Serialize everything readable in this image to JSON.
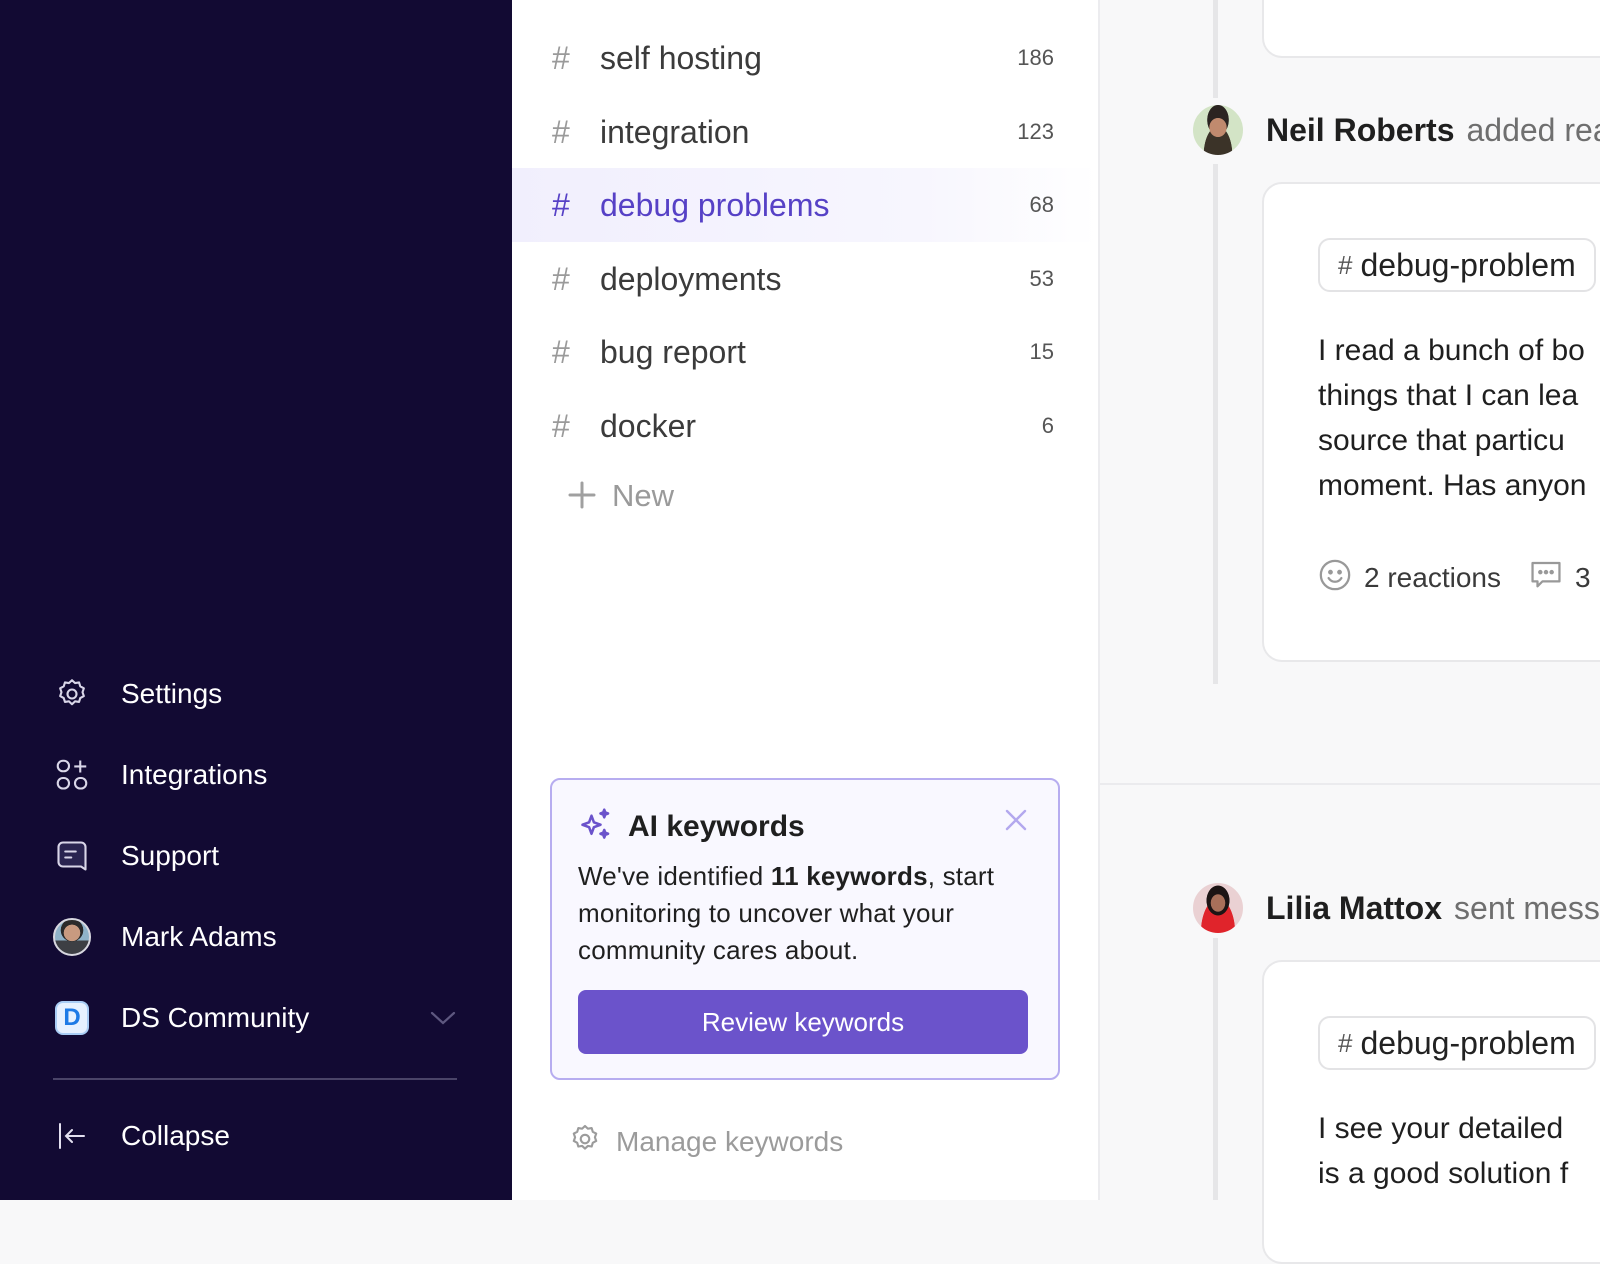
{
  "sidebar": {
    "items": [
      {
        "label": "Settings",
        "icon": "gear-icon"
      },
      {
        "label": "Integrations",
        "icon": "integrations-icon"
      },
      {
        "label": "Support",
        "icon": "chat-bubble-icon"
      },
      {
        "label": "Mark Adams",
        "icon": "avatar"
      },
      {
        "label": "DS Community",
        "icon": "workspace-badge",
        "badge_letter": "D"
      }
    ],
    "collapse_label": "Collapse"
  },
  "keywords": {
    "items": [
      {
        "label": "self hosting",
        "count": "186",
        "active": false
      },
      {
        "label": "integration",
        "count": "123",
        "active": false
      },
      {
        "label": "debug problems",
        "count": "68",
        "active": true
      },
      {
        "label": "deployments",
        "count": "53",
        "active": false
      },
      {
        "label": "bug report",
        "count": "15",
        "active": false
      },
      {
        "label": "docker",
        "count": "6",
        "active": false
      }
    ],
    "hash_symbol": "#",
    "new_label": "New",
    "ai_card": {
      "title": "AI keywords",
      "body_prefix": "We've identified ",
      "body_bold": "11 keywords",
      "body_suffix": ", start monitoring to uncover what your community cares about.",
      "button_label": "Review keywords"
    },
    "manage_label": "Manage keywords"
  },
  "feed": {
    "posts": [
      {
        "author": "Neil Roberts",
        "action": "added rea",
        "channel": "debug-problem",
        "text_lines": [
          "I read a bunch of bo",
          "things that I can lea",
          "source that particu",
          "moment. Has anyon"
        ],
        "reactions_label": "2 reactions",
        "comments_count": "3"
      },
      {
        "author": "Lilia Mattox",
        "action": "sent mess",
        "channel": "debug-problem",
        "text_lines": [
          "I see your detailed",
          "is a good solution f"
        ]
      }
    ]
  },
  "colors": {
    "sidebar_bg": "#120a33",
    "accent": "#6b53cb",
    "active_text": "#5641c6",
    "card_border": "#b7adf0"
  }
}
